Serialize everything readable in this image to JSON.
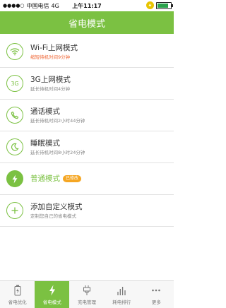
{
  "status_bar": {
    "carrier": "中国电信",
    "network": "4G",
    "time": "上午11:17"
  },
  "header": {
    "title": "省电模式"
  },
  "modes": [
    {
      "icon": "wifi-icon",
      "title": "Wi-Fi上网模式",
      "subtitle": "缩短待机时间9分钟",
      "subtitle_warn": true
    },
    {
      "icon": "3g-icon",
      "icon_text": "3G",
      "title": "3G上网模式",
      "subtitle": "延长待机时间4分钟"
    },
    {
      "icon": "phone-icon",
      "title": "通话模式",
      "subtitle": "延长待机时间2小时44分钟"
    },
    {
      "icon": "moon-icon",
      "title": "睡眠模式",
      "subtitle": "延长待机时间8小时24分钟"
    },
    {
      "icon": "lightning-icon",
      "title": "普通模式",
      "badge": "已修改",
      "active": true
    },
    {
      "icon": "plus-icon",
      "title": "添加自定义模式",
      "subtitle": "定制您自己的省电模式"
    }
  ],
  "tabs": [
    {
      "label": "省电优化",
      "icon": "battery-optimize-icon"
    },
    {
      "label": "省电模式",
      "icon": "lightning-icon",
      "active": true
    },
    {
      "label": "充电管理",
      "icon": "plug-icon"
    },
    {
      "label": "耗电排行",
      "icon": "bar-chart-icon"
    },
    {
      "label": "更多",
      "icon": "more-icon"
    }
  ],
  "colors": {
    "accent": "#7bc142",
    "warn": "#f06a3a",
    "badge": "#f5a623"
  }
}
